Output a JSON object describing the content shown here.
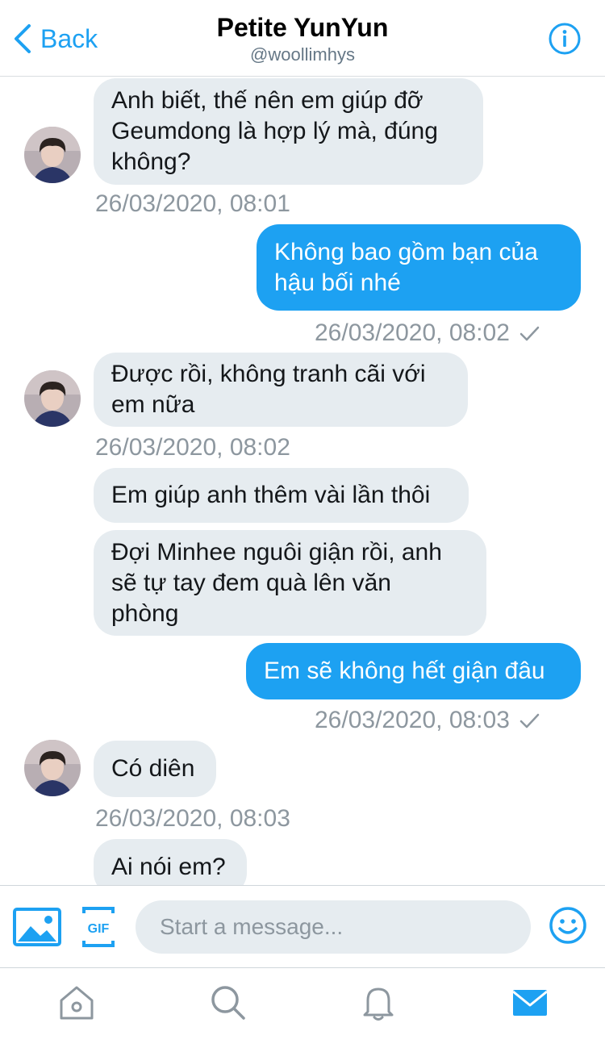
{
  "header": {
    "back_label": "Back",
    "title": "Petite YunYun",
    "handle": "@woollimhys"
  },
  "messages": [
    {
      "dir": "in",
      "text": "Anh biết, thế nên em giúp đỡ\nGeumdong là hợp lý mà, đúng\nkhông?"
    },
    {
      "dir": "in",
      "timestamp": "26/03/2020, 08:01"
    },
    {
      "dir": "out",
      "text": "Không bao gồm bạn của\nhậu bối nhé"
    },
    {
      "dir": "out",
      "timestamp": "26/03/2020, 08:02"
    },
    {
      "dir": "in",
      "text": "Được rồi, không tranh cãi với\nem nữa"
    },
    {
      "dir": "in",
      "timestamp": "26/03/2020, 08:02"
    },
    {
      "dir": "in",
      "text": "Em giúp anh thêm vài lần thôi"
    },
    {
      "dir": "in",
      "text": "Đợi Minhee nguôi giận rồi, anh\nsẽ tự tay đem quà lên văn\nphòng"
    },
    {
      "dir": "out",
      "text": "Em sẽ không hết giận đâu"
    },
    {
      "dir": "out",
      "timestamp": "26/03/2020, 08:03"
    },
    {
      "dir": "in",
      "text": "Có diên"
    },
    {
      "dir": "in",
      "timestamp": "26/03/2020, 08:03"
    },
    {
      "dir": "in",
      "text": "Ai nói em?"
    }
  ],
  "composer": {
    "placeholder": "Start a message...",
    "gif_label": "GIF"
  },
  "tabs": [
    "home",
    "search",
    "notifications",
    "messages"
  ],
  "colors": {
    "accent": "#1da1f2",
    "incoming_bubble": "#e6ecf0",
    "timestamp": "#8d979f",
    "icon_inactive": "#8d979f"
  }
}
